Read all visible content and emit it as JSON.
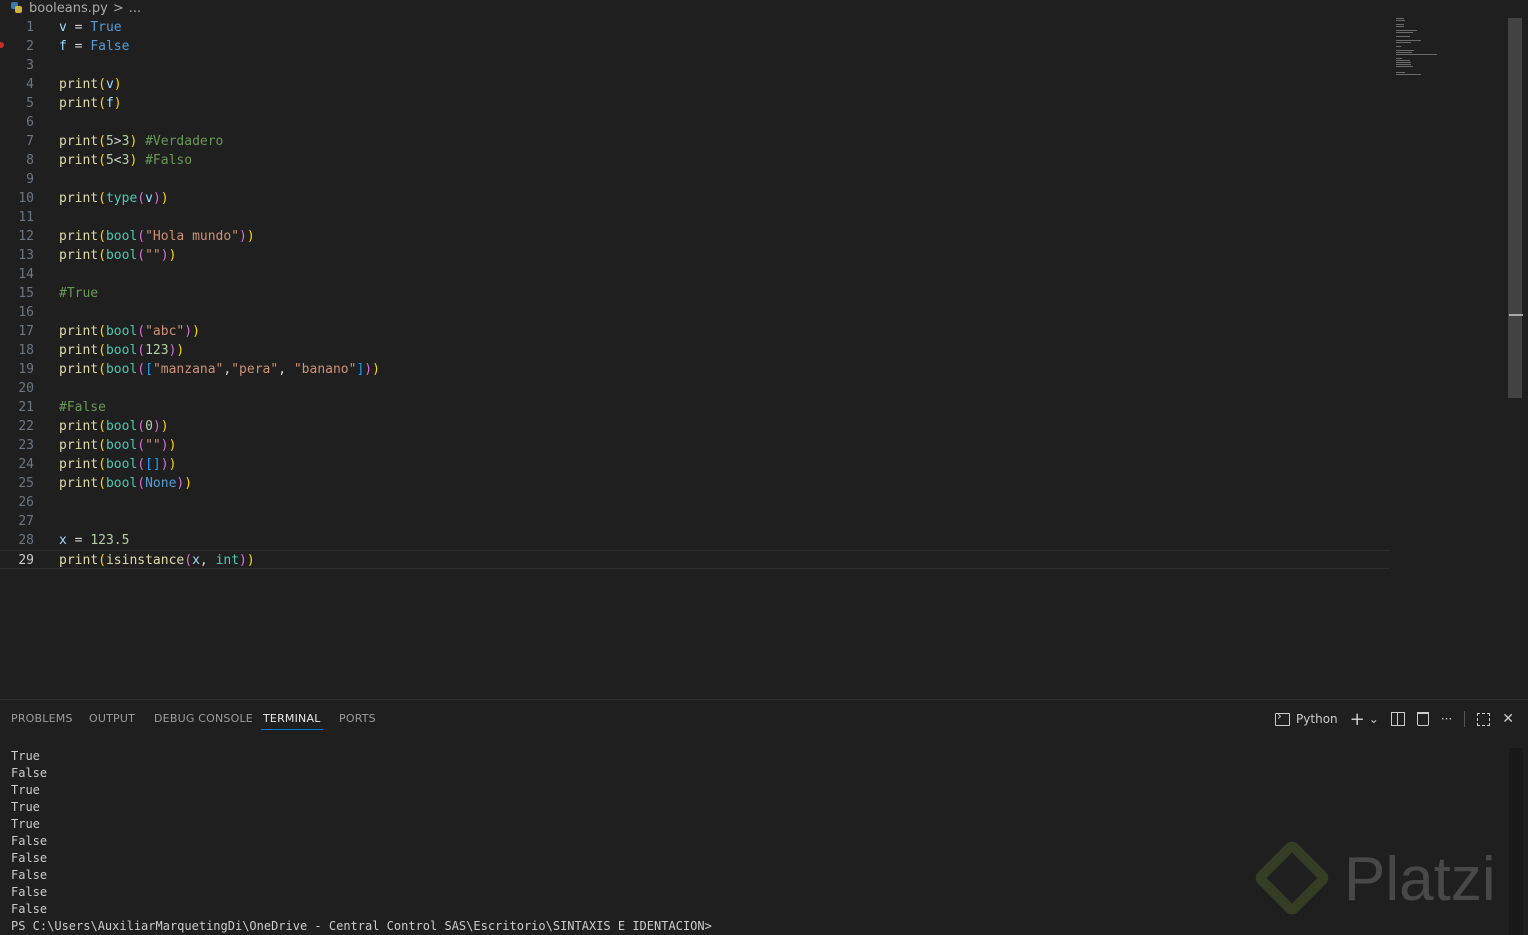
{
  "breadcrumb": {
    "file": "booleans.py",
    "sep": ">",
    "more": "..."
  },
  "editor": {
    "current_line": 29,
    "lines": [
      {
        "n": "1",
        "tokens": [
          [
            "v",
            "v"
          ],
          [
            "",
            " = "
          ],
          [
            "b",
            "True"
          ]
        ]
      },
      {
        "n": "2",
        "tokens": [
          [
            "v",
            "f"
          ],
          [
            "",
            " = "
          ],
          [
            "b",
            "False"
          ]
        ]
      },
      {
        "n": "3",
        "tokens": []
      },
      {
        "n": "4",
        "tokens": [
          [
            "k",
            "print"
          ],
          [
            "p1",
            "("
          ],
          [
            "v",
            "v"
          ],
          [
            "p1",
            ")"
          ]
        ]
      },
      {
        "n": "5",
        "tokens": [
          [
            "k",
            "print"
          ],
          [
            "p1",
            "("
          ],
          [
            "v",
            "f"
          ],
          [
            "p1",
            ")"
          ]
        ]
      },
      {
        "n": "6",
        "tokens": []
      },
      {
        "n": "7",
        "tokens": [
          [
            "k",
            "print"
          ],
          [
            "p1",
            "("
          ],
          [
            "n",
            "5"
          ],
          [
            "",
            ">"
          ],
          [
            "n",
            "3"
          ],
          [
            "p1",
            ")"
          ],
          [
            "",
            " "
          ],
          [
            "c",
            "#Verdadero"
          ]
        ]
      },
      {
        "n": "8",
        "tokens": [
          [
            "k",
            "print"
          ],
          [
            "p1",
            "("
          ],
          [
            "n",
            "5"
          ],
          [
            "",
            "<"
          ],
          [
            "n",
            "3"
          ],
          [
            "p1",
            ")"
          ],
          [
            "",
            " "
          ],
          [
            "c",
            "#Falso"
          ]
        ]
      },
      {
        "n": "9",
        "tokens": []
      },
      {
        "n": "10",
        "tokens": [
          [
            "k",
            "print"
          ],
          [
            "p1",
            "("
          ],
          [
            "t",
            "type"
          ],
          [
            "p2",
            "("
          ],
          [
            "v",
            "v"
          ],
          [
            "p2",
            ")"
          ],
          [
            "p1",
            ")"
          ]
        ]
      },
      {
        "n": "11",
        "tokens": []
      },
      {
        "n": "12",
        "tokens": [
          [
            "k",
            "print"
          ],
          [
            "p1",
            "("
          ],
          [
            "t",
            "bool"
          ],
          [
            "p2",
            "("
          ],
          [
            "s",
            "\"Hola mundo\""
          ],
          [
            "p2",
            ")"
          ],
          [
            "p1",
            ")"
          ]
        ]
      },
      {
        "n": "13",
        "tokens": [
          [
            "k",
            "print"
          ],
          [
            "p1",
            "("
          ],
          [
            "t",
            "bool"
          ],
          [
            "p2",
            "("
          ],
          [
            "s",
            "\"\""
          ],
          [
            "p2",
            ")"
          ],
          [
            "p1",
            ")"
          ]
        ]
      },
      {
        "n": "14",
        "tokens": []
      },
      {
        "n": "15",
        "tokens": [
          [
            "c",
            "#True"
          ]
        ]
      },
      {
        "n": "16",
        "tokens": []
      },
      {
        "n": "17",
        "tokens": [
          [
            "k",
            "print"
          ],
          [
            "p1",
            "("
          ],
          [
            "t",
            "bool"
          ],
          [
            "p2",
            "("
          ],
          [
            "s",
            "\"abc\""
          ],
          [
            "p2",
            ")"
          ],
          [
            "p1",
            ")"
          ]
        ]
      },
      {
        "n": "18",
        "tokens": [
          [
            "k",
            "print"
          ],
          [
            "p1",
            "("
          ],
          [
            "t",
            "bool"
          ],
          [
            "p2",
            "("
          ],
          [
            "n",
            "123"
          ],
          [
            "p2",
            ")"
          ],
          [
            "p1",
            ")"
          ]
        ]
      },
      {
        "n": "19",
        "tokens": [
          [
            "k",
            "print"
          ],
          [
            "p1",
            "("
          ],
          [
            "t",
            "bool"
          ],
          [
            "p2",
            "("
          ],
          [
            "p3",
            "["
          ],
          [
            "s",
            "\"manzana\""
          ],
          [
            "",
            ","
          ],
          [
            "s",
            "\"pera\""
          ],
          [
            "",
            ", "
          ],
          [
            "s",
            "\"banano\""
          ],
          [
            "p3",
            "]"
          ],
          [
            "p2",
            ")"
          ],
          [
            "p1",
            ")"
          ]
        ]
      },
      {
        "n": "20",
        "tokens": []
      },
      {
        "n": "21",
        "tokens": [
          [
            "c",
            "#False"
          ]
        ]
      },
      {
        "n": "22",
        "tokens": [
          [
            "k",
            "print"
          ],
          [
            "p1",
            "("
          ],
          [
            "t",
            "bool"
          ],
          [
            "p2",
            "("
          ],
          [
            "n",
            "0"
          ],
          [
            "p2",
            ")"
          ],
          [
            "p1",
            ")"
          ]
        ]
      },
      {
        "n": "23",
        "tokens": [
          [
            "k",
            "print"
          ],
          [
            "p1",
            "("
          ],
          [
            "t",
            "bool"
          ],
          [
            "p2",
            "("
          ],
          [
            "s",
            "\"\""
          ],
          [
            "p2",
            ")"
          ],
          [
            "p1",
            ")"
          ]
        ]
      },
      {
        "n": "24",
        "tokens": [
          [
            "k",
            "print"
          ],
          [
            "p1",
            "("
          ],
          [
            "t",
            "bool"
          ],
          [
            "p2",
            "("
          ],
          [
            "p3",
            "[]"
          ],
          [
            "p2",
            ")"
          ],
          [
            "p1",
            ")"
          ]
        ]
      },
      {
        "n": "25",
        "tokens": [
          [
            "k",
            "print"
          ],
          [
            "p1",
            "("
          ],
          [
            "t",
            "bool"
          ],
          [
            "p2",
            "("
          ],
          [
            "b",
            "None"
          ],
          [
            "p2",
            ")"
          ],
          [
            "p1",
            ")"
          ]
        ]
      },
      {
        "n": "26",
        "tokens": []
      },
      {
        "n": "27",
        "tokens": []
      },
      {
        "n": "28",
        "tokens": [
          [
            "v",
            "x"
          ],
          [
            "",
            " = "
          ],
          [
            "n",
            "123.5"
          ]
        ]
      },
      {
        "n": "29",
        "tokens": [
          [
            "k",
            "print"
          ],
          [
            "p1",
            "("
          ],
          [
            "k",
            "isinstance"
          ],
          [
            "p2",
            "("
          ],
          [
            "v",
            "x"
          ],
          [
            "",
            ", "
          ],
          [
            "t",
            "int"
          ],
          [
            "p2",
            ")"
          ],
          [
            "p1",
            ")"
          ]
        ]
      }
    ]
  },
  "panel": {
    "tabs": [
      {
        "label": "PROBLEMS",
        "active": false
      },
      {
        "label": "OUTPUT",
        "active": false
      },
      {
        "label": "DEBUG CONSOLE",
        "active": false
      },
      {
        "label": "TERMINAL",
        "active": true
      },
      {
        "label": "PORTS",
        "active": false
      }
    ],
    "terminal_profile": "Python",
    "add_symbol": "+",
    "chevron_symbol": "⌄",
    "more_symbol": "···",
    "close_symbol": "✕",
    "output": [
      "True",
      "False",
      "True",
      "True",
      "True",
      "False",
      "False",
      "False",
      "False",
      "False"
    ],
    "prompt": "PS C:\\Users\\AuxiliarMarquetingDi\\OneDrive - Central Control SAS\\Escritorio\\SINTAXIS E IDENTACION>"
  },
  "watermark": "Platzi",
  "colors": {
    "background": "#1f1f1f",
    "accent": "#0078d4",
    "function": "#dcdcaa",
    "keyword": "#569cd6",
    "variable": "#9cdcfe",
    "type": "#4ec9b0",
    "string": "#ce9178",
    "number": "#b5cea8",
    "comment": "#6a9955"
  }
}
